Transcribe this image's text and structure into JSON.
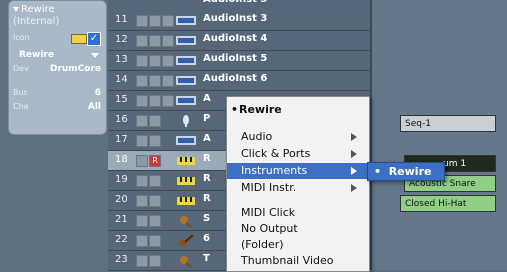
{
  "inspector": {
    "title": "Rewire",
    "subtitle": "(Internal)",
    "icon_label": "Icon",
    "output_value": "Rewire",
    "dev_label": "Dev",
    "dev_value": "DrumCore",
    "bus_label": "Bus",
    "bus_value": "6",
    "cha_label": "Cha",
    "cha_value": "All"
  },
  "tracks": [
    {
      "num": "11",
      "name": "AudioInst 3"
    },
    {
      "num": "12",
      "name": "AudioInst 4"
    },
    {
      "num": "13",
      "name": "AudioInst 5"
    },
    {
      "num": "14",
      "name": "AudioInst 6"
    },
    {
      "num": "15",
      "name": "A"
    },
    {
      "num": "16",
      "name": "P"
    },
    {
      "num": "17",
      "name": "A"
    },
    {
      "num": "18",
      "name": "R",
      "rec": "R"
    },
    {
      "num": "19",
      "name": "R"
    },
    {
      "num": "20",
      "name": "R"
    },
    {
      "num": "21",
      "name": "S"
    },
    {
      "num": "22",
      "name": "6"
    },
    {
      "num": "23",
      "name": "T"
    }
  ],
  "menu": {
    "header": "Rewire",
    "items": [
      "Audio",
      "Click & Ports",
      "Instruments",
      "MIDI Instr.",
      "MIDI Click",
      "No Output",
      "(Folder)",
      "Thumbnail Video"
    ]
  },
  "submenu": {
    "item": "Rewire"
  },
  "parts": {
    "seq": "Seq-1",
    "sum": "um 1",
    "snare": "Acoustic Snare",
    "hihat": "Closed Hi-Hat"
  },
  "colors": {
    "menu_highlight": "#3d6fc4",
    "part_green": "#8fcf86"
  }
}
